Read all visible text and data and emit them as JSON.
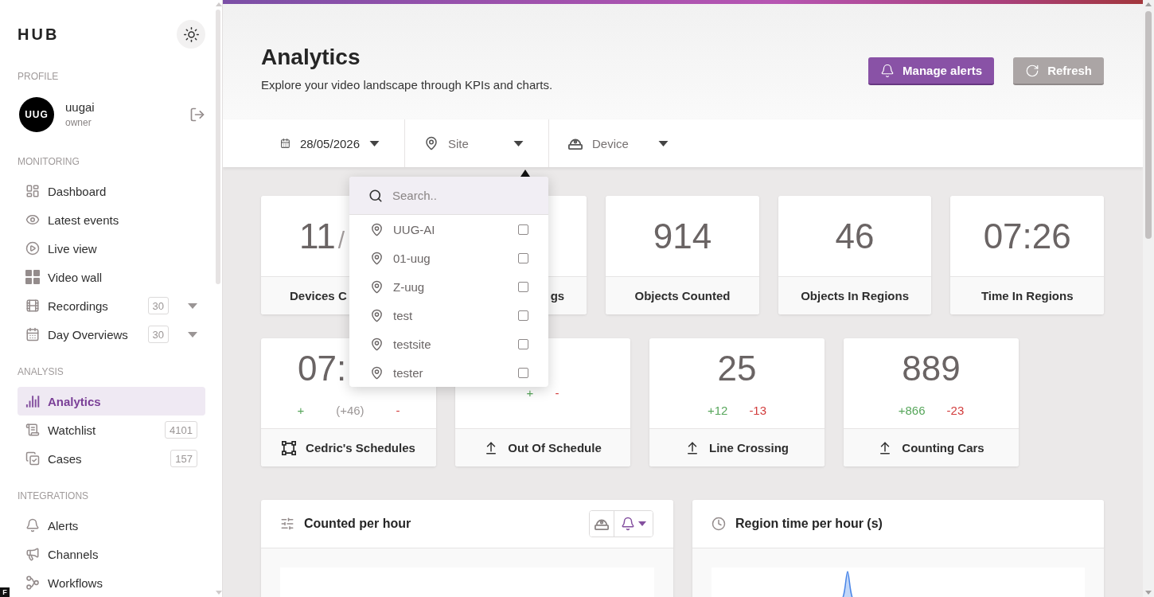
{
  "sidebar": {
    "brand": "HUB",
    "profile": {
      "section": "PROFILE",
      "avatar": "UUG",
      "name": "uugai",
      "role": "owner"
    },
    "sections": [
      {
        "title": "MONITORING",
        "items": [
          {
            "label": "Dashboard",
            "kind": "link",
            "selected": false
          },
          {
            "label": "Latest events",
            "kind": "link",
            "selected": false
          },
          {
            "label": "Live view",
            "kind": "link",
            "selected": false
          },
          {
            "label": "Video wall",
            "kind": "link",
            "selected": false
          },
          {
            "label": "Recordings",
            "kind": "group",
            "badge": "30",
            "expanded": false,
            "selected": false
          },
          {
            "label": "Day Overviews",
            "kind": "group",
            "badge": "30",
            "expanded": false,
            "selected": false
          }
        ]
      },
      {
        "title": "ANALYSIS",
        "items": [
          {
            "label": "Analytics",
            "kind": "link",
            "selected": true
          },
          {
            "label": "Watchlist",
            "kind": "link",
            "badge": "4101",
            "selected": false
          },
          {
            "label": "Cases",
            "kind": "link",
            "badge": "157",
            "selected": false
          }
        ]
      },
      {
        "title": "INTEGRATIONS",
        "items": [
          {
            "label": "Alerts",
            "kind": "link",
            "selected": false
          },
          {
            "label": "Channels",
            "kind": "link",
            "selected": false
          },
          {
            "label": "Workflows",
            "kind": "link",
            "selected": false
          }
        ]
      }
    ]
  },
  "header": {
    "title": "Analytics",
    "subtitle": "Explore your video landscape through KPIs and charts.",
    "buttons": [
      {
        "label": "Manage alerts",
        "kind": "primary"
      },
      {
        "label": "Refresh",
        "kind": "secondary"
      }
    ]
  },
  "filters": [
    {
      "kind": "date",
      "value": "28/05/2026"
    },
    {
      "kind": "site",
      "placeholder": "Site",
      "menu": {
        "search": {
          "placeholder": "Search.."
        },
        "options": [
          {
            "label": "UUG-AI",
            "checked": false
          },
          {
            "label": "01-uug",
            "checked": false
          },
          {
            "label": "Z-uug",
            "checked": false
          },
          {
            "label": "test",
            "checked": false
          },
          {
            "label": "testsite",
            "checked": false
          },
          {
            "label": "tester",
            "checked": false
          }
        ]
      }
    },
    {
      "kind": "device",
      "placeholder": "Device"
    }
  ],
  "kpis": [
    {
      "value": "11",
      "value_tail": "/",
      "label": "Devices C"
    },
    {
      "label": "gs"
    },
    {
      "value": "914",
      "label": "Objects Counted"
    },
    {
      "value": "46",
      "label": "Objects In Regions"
    },
    {
      "value": "07:26",
      "label": "Time In Regions"
    }
  ],
  "event_cards": [
    {
      "kind": "region",
      "value": "07:",
      "deltas": [
        {
          "kind": "up",
          "text": "+"
        },
        {
          "kind": "net",
          "text": "(+46)"
        },
        {
          "kind": "down",
          "text": "-"
        }
      ],
      "label": "Cedric's Schedules"
    },
    {
      "kind": "line",
      "deltas": [
        {
          "kind": "up",
          "text": "+"
        },
        {
          "kind": "down",
          "text": "-"
        }
      ],
      "label": "Out Of Schedule"
    },
    {
      "kind": "line",
      "value": "25",
      "deltas": [
        {
          "kind": "up",
          "text": "+12"
        },
        {
          "kind": "down",
          "text": "-13"
        }
      ],
      "label": "Line Crossing"
    },
    {
      "kind": "line",
      "value": "889",
      "deltas": [
        {
          "kind": "up",
          "text": "+866"
        },
        {
          "kind": "down",
          "text": "-23"
        }
      ],
      "label": "Counting Cars"
    }
  ],
  "charts": [
    {
      "kind": "counts",
      "title": "Counted per hour"
    },
    {
      "kind": "region_time",
      "title": "Region time per hour (s)"
    }
  ],
  "corner_badge": "F"
}
